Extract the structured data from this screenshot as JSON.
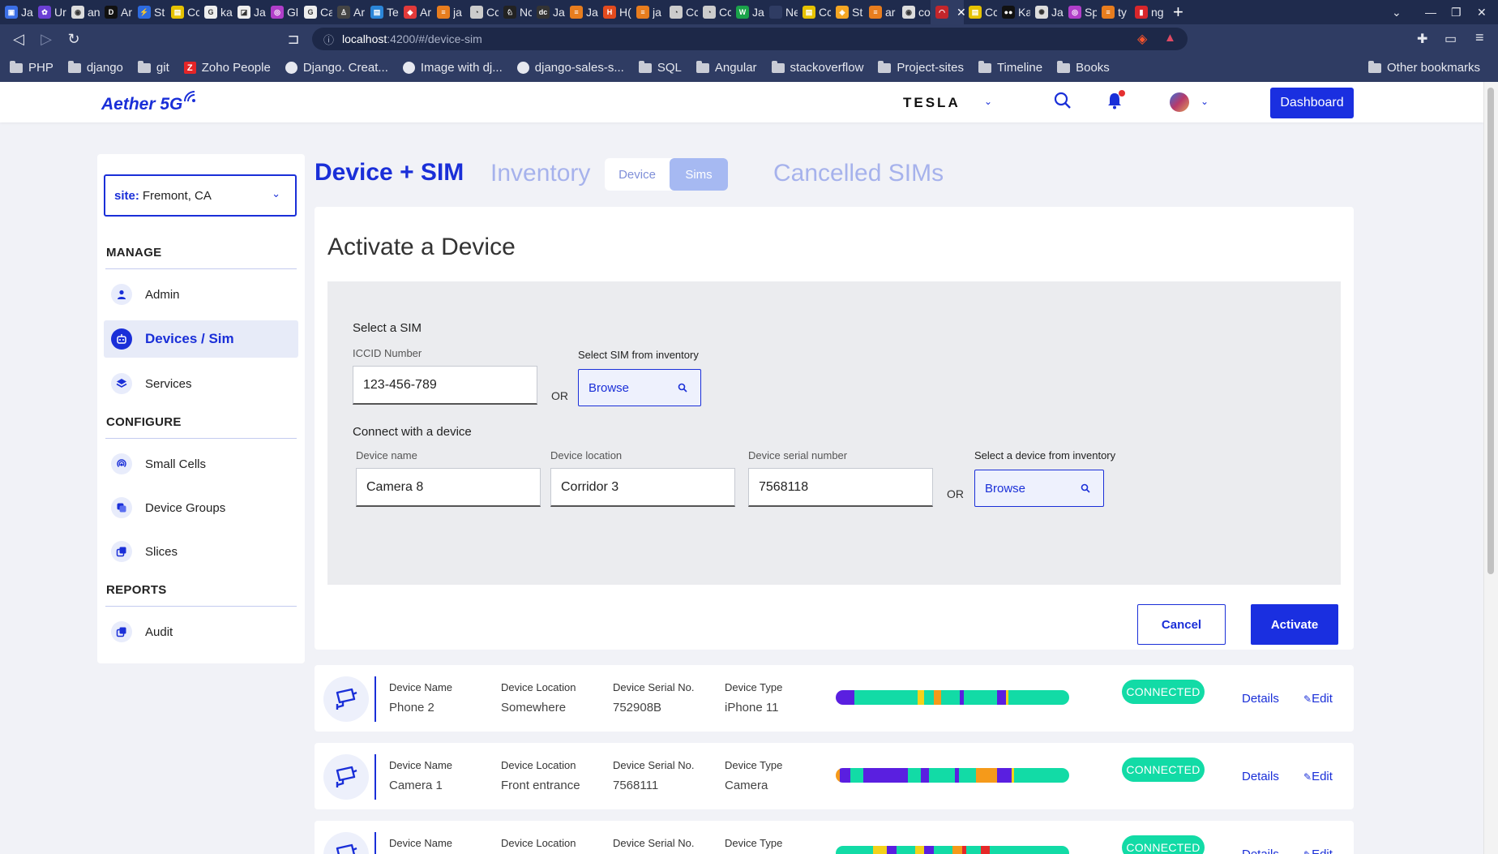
{
  "browser": {
    "tabs": [
      {
        "fav": "#3b6fe6",
        "g": "▣",
        "t": "Ja"
      },
      {
        "fav": "#6b3fd4",
        "g": "✿",
        "t": "Ur"
      },
      {
        "fav": "#ddd",
        "g": "◉",
        "t": "an"
      },
      {
        "fav": "#111",
        "g": "D",
        "t": "Ar"
      },
      {
        "fav": "#2d6be0",
        "g": "⚡",
        "t": "St"
      },
      {
        "fav": "#e6c200",
        "g": "▤",
        "t": "Cc"
      },
      {
        "fav": "#eee",
        "g": "G",
        "t": "ka"
      },
      {
        "fav": "#eee",
        "g": "◪",
        "t": "Ja"
      },
      {
        "fav": "#b13ec9",
        "g": "◎",
        "t": "Gl"
      },
      {
        "fav": "#eee",
        "g": "G",
        "t": "Ca"
      },
      {
        "fav": "#444",
        "g": "♙",
        "t": "Ar"
      },
      {
        "fav": "#2b86d9",
        "g": "▤",
        "t": "Te"
      },
      {
        "fav": "#e23a3a",
        "g": "◆",
        "t": "Ar"
      },
      {
        "fav": "#e87d1e",
        "g": "≡",
        "t": "ja"
      },
      {
        "fav": "#ccc",
        "g": "◔",
        "t": "Cc"
      },
      {
        "fav": "#222",
        "g": "♘",
        "t": "Nc"
      },
      {
        "fav": "#333",
        "g": "dc",
        "t": "Ja"
      },
      {
        "fav": "#e87d1e",
        "g": "≡",
        "t": "Ja"
      },
      {
        "fav": "#e34b1e",
        "g": "H",
        "t": "H("
      },
      {
        "fav": "#e87d1e",
        "g": "≡",
        "t": "ja"
      },
      {
        "fav": "#ccc",
        "g": "◔",
        "t": "Cc"
      },
      {
        "fav": "#ccc",
        "g": "◔",
        "t": "Cc"
      },
      {
        "fav": "#1aa24a",
        "g": "W",
        "t": "Ja"
      },
      {
        "fav": "#2f3c63",
        "g": "",
        "t": "New"
      },
      {
        "fav": "#e6c200",
        "g": "▤",
        "t": "Cc"
      },
      {
        "fav": "#f5a623",
        "g": "◈",
        "t": "St"
      },
      {
        "fav": "#e87d1e",
        "g": "≡",
        "t": "ar"
      },
      {
        "fav": "#ddd",
        "g": "◉",
        "t": "co"
      },
      {
        "fav": "#c3262b",
        "g": "◠",
        "t": ""
      },
      {
        "fav": "#e6c200",
        "g": "▤",
        "t": "Cc"
      },
      {
        "fav": "#111",
        "g": "●●",
        "t": "Ka"
      },
      {
        "fav": "#ddd",
        "g": "✺",
        "t": "Ja"
      },
      {
        "fav": "#b13ec9",
        "g": "◎",
        "t": "Sp"
      },
      {
        "fav": "#e87d1e",
        "g": "≡",
        "t": "ty"
      },
      {
        "fav": "#d8262b",
        "g": "▮",
        "t": "ng"
      }
    ],
    "active_tab_index": 28,
    "url_host": "localhost",
    "url_path": ":4200/#/device-sim",
    "bookmarks": [
      {
        "type": "folder",
        "label": "PHP"
      },
      {
        "type": "folder",
        "label": "django"
      },
      {
        "type": "folder",
        "label": "git"
      },
      {
        "type": "zoho",
        "label": "Zoho People"
      },
      {
        "type": "gh",
        "label": "Django. Creat..."
      },
      {
        "type": "gh",
        "label": "Image with dj..."
      },
      {
        "type": "gh",
        "label": "django-sales-s..."
      },
      {
        "type": "folder",
        "label": "SQL"
      },
      {
        "type": "folder",
        "label": "Angular"
      },
      {
        "type": "folder",
        "label": "stackoverflow"
      },
      {
        "type": "folder",
        "label": "Project-sites"
      },
      {
        "type": "folder",
        "label": "Timeline"
      },
      {
        "type": "folder",
        "label": "Books"
      }
    ],
    "other_bookmarks": "Other bookmarks"
  },
  "header": {
    "logo": "Aether 5G",
    "brand": "TESLA",
    "dashboard_label": "Dashboard"
  },
  "sidebar": {
    "site_label": "site:",
    "site_value": "Fremont, CA",
    "manage_title": "MANAGE",
    "configure_title": "CONFIGURE",
    "reports_title": "REPORTS",
    "items": {
      "admin": "Admin",
      "devices": "Devices / Sim",
      "services": "Services",
      "small_cells": "Small Cells",
      "device_groups": "Device Groups",
      "slices": "Slices",
      "audit": "Audit"
    }
  },
  "main": {
    "tab_device_sim": "Device + SIM",
    "tab_inventory": "Inventory",
    "seg_device": "Device",
    "seg_sims": "Sims",
    "tab_cancelled": "Cancelled SIMs"
  },
  "activate": {
    "title": "Activate a Device",
    "select_sim_title": "Select a SIM",
    "iccid_label": "ICCID Number",
    "iccid_value": "123-456-789",
    "or": "OR",
    "select_sim_inventory": "Select SIM from inventory",
    "browse": "Browse",
    "connect_title": "Connect with a device",
    "device_name_label": "Device name",
    "device_name_value": "Camera 8",
    "device_location_label": "Device location",
    "device_location_value": "Corridor 3",
    "device_serial_label": "Device serial number",
    "device_serial_value": "7568118",
    "select_device_inventory": "Select a device from inventory",
    "cancel": "Cancel",
    "activate": "Activate"
  },
  "table_headers": {
    "name": "Device Name",
    "location": "Device Location",
    "serial": "Device Serial No.",
    "type": "Device Type"
  },
  "devices": [
    {
      "name": "Phone 2",
      "location": "Somewhere",
      "serial": "752908B",
      "type": "iPhone 11",
      "status": "CONNECTED",
      "details": "Details",
      "edit": "Edit"
    },
    {
      "name": "Camera 1",
      "location": "Front entrance",
      "serial": "7568111",
      "type": "Camera",
      "status": "CONNECTED",
      "details": "Details",
      "edit": "Edit"
    },
    {
      "name": "",
      "location": "",
      "serial": "",
      "type": "",
      "status": "CONNECTED",
      "details": "Details",
      "edit": "Edit"
    }
  ],
  "colors": {
    "primary": "#1a2fd8",
    "connected": "#12dba6",
    "bar_green": "#12dba6",
    "bar_purple": "#5a1fe0",
    "bar_yellow": "#f3d21a",
    "bar_orange": "#f59a1a",
    "bar_red": "#e52929"
  }
}
